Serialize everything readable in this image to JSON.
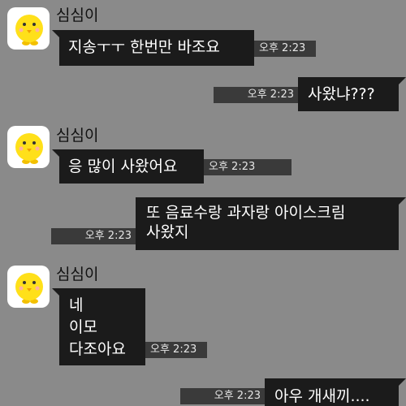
{
  "chat": {
    "sender_name": "심심이",
    "avatar_icon": "yellow-chick-avatar-icon",
    "colors": {
      "background": "#8a8a8a",
      "bubble": "#1b1b1b",
      "time_label": "#3a3a3a"
    },
    "messages": [
      {
        "direction": "in",
        "lines": [
          "지송ㅜㅜ 한번만 바조요"
        ],
        "time": "오후 2:23"
      },
      {
        "direction": "out",
        "lines": [
          "사왔냐???"
        ],
        "time": "오후 2:23"
      },
      {
        "direction": "in",
        "lines": [
          "응 많이 사왔어요"
        ],
        "time": "오후 2:23"
      },
      {
        "direction": "out",
        "lines": [
          "또 음료수랑 과자랑 아이스크림",
          "사왔지"
        ],
        "time": "오후 2:23"
      },
      {
        "direction": "in",
        "lines": [
          "네",
          "이모",
          "다조아요"
        ],
        "time": "오후 2:23"
      },
      {
        "direction": "out",
        "lines": [
          "아우 개새끼...."
        ],
        "time": "오후 2:23"
      }
    ]
  }
}
